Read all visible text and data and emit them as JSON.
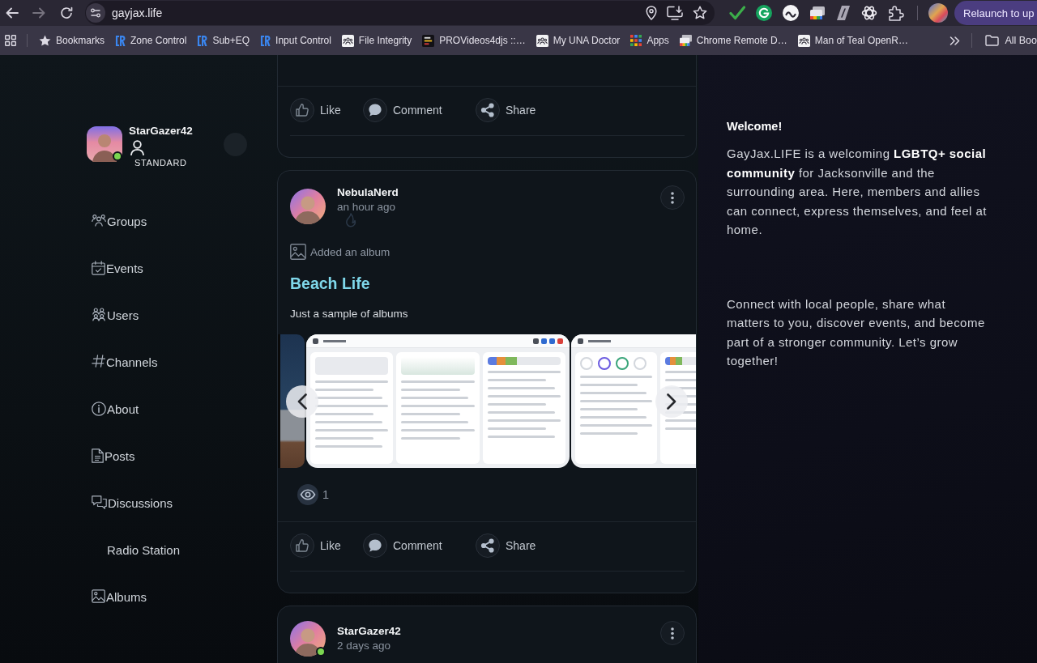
{
  "browser": {
    "url": "gayjax.life",
    "relaunch": "Relaunch to up",
    "bookmarks": [
      {
        "label": "Bookmarks"
      },
      {
        "label": "Zone Control"
      },
      {
        "label": "Sub+EQ"
      },
      {
        "label": "Input Control"
      },
      {
        "label": "File Integrity"
      },
      {
        "label": "PROVideos4djs ::…"
      },
      {
        "label": "My UNA Doctor"
      },
      {
        "label": "Apps"
      },
      {
        "label": "Chrome Remote D…"
      },
      {
        "label": "Man of Teal OpenR…"
      }
    ],
    "all_bookmarks": "All Boo"
  },
  "sidebar": {
    "user": {
      "name": "StarGazer42",
      "role": "STANDARD",
      "online": true
    },
    "items": [
      {
        "label": "Groups"
      },
      {
        "label": "Events"
      },
      {
        "label": "Users"
      },
      {
        "label": "Channels"
      },
      {
        "label": "About"
      },
      {
        "label": "Posts"
      },
      {
        "label": "Discussions"
      },
      {
        "label": "Radio Station"
      },
      {
        "label": "Albums"
      }
    ]
  },
  "feed": {
    "posts": [
      {
        "actions": [
          "Like",
          "Comment",
          "Share"
        ]
      },
      {
        "author": "NebulaNerd",
        "time": "an hour ago",
        "online": false,
        "activity": "Added an album",
        "title": "Beach Life",
        "text": "Just a sample of albums",
        "views": "1",
        "actions": [
          "Like",
          "Comment",
          "Share"
        ]
      },
      {
        "author": "StarGazer42",
        "time": "2 days ago",
        "online": true
      }
    ]
  },
  "welcome": {
    "title": "Welcome!",
    "paragraphs": [
      "GayJax.LIFE is a welcoming **LGBTQ+ social community** for Jacksonville and the surrounding area. Here, members and allies can connect, express themselves, and feel at home.",
      "Connect with local people, share what matters to you, discover events, and become part of a stronger community. Let’s grow together!"
    ]
  }
}
